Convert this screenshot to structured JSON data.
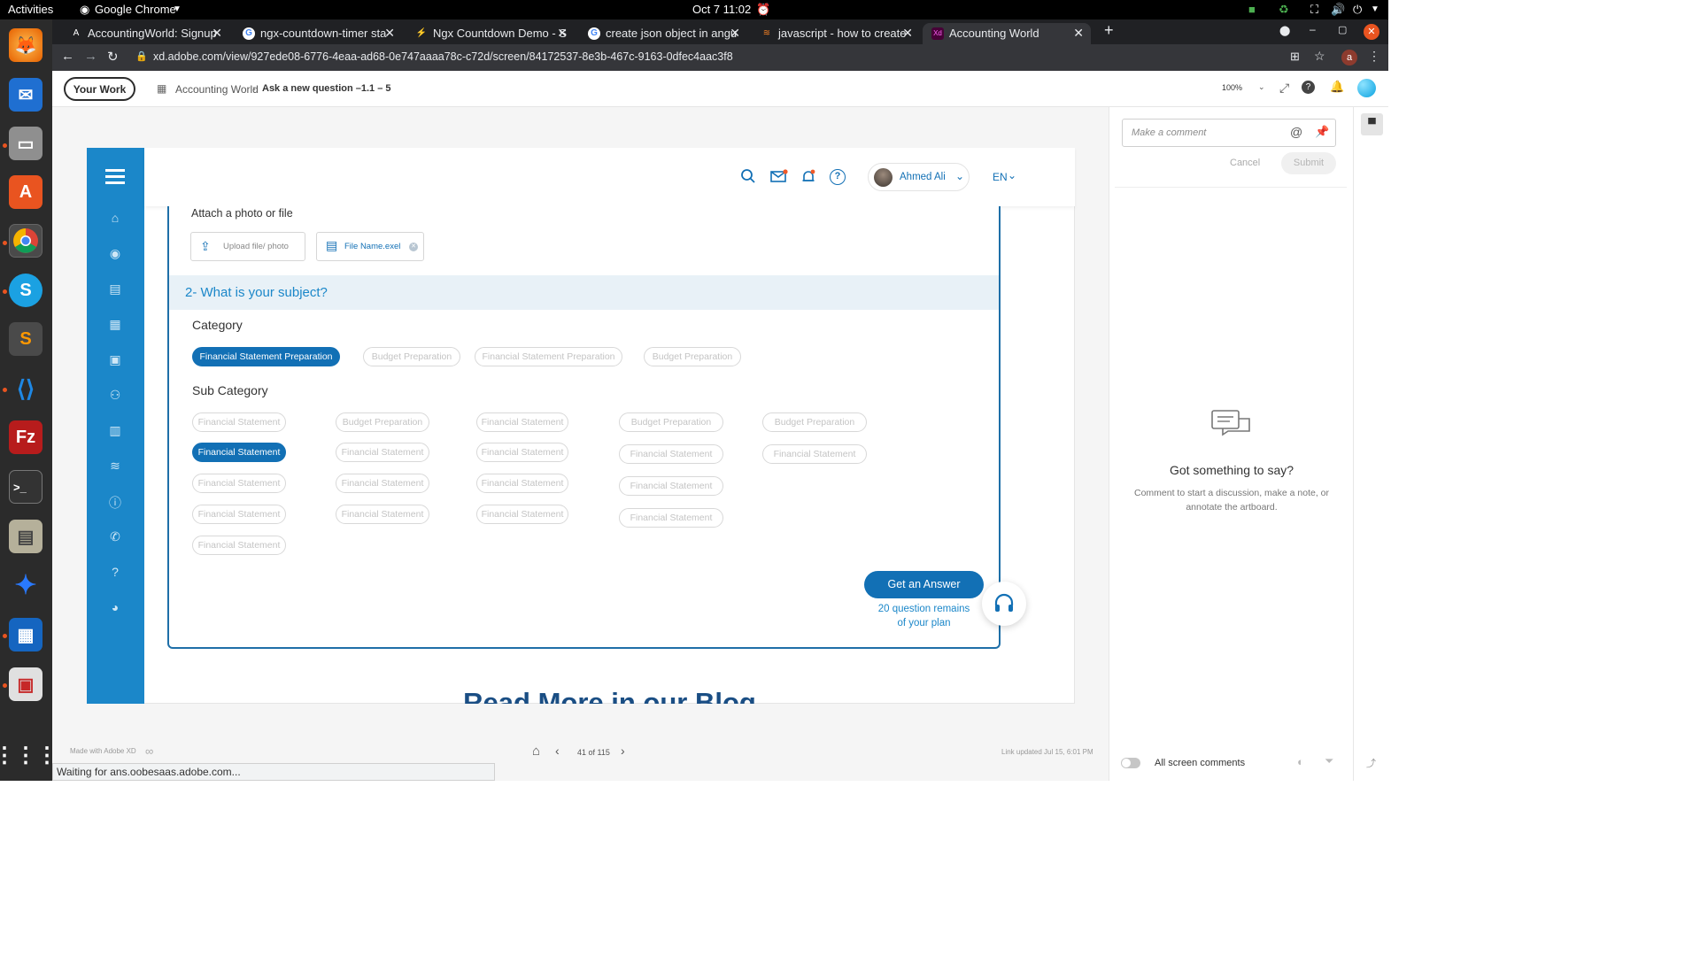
{
  "os": {
    "activities": "Activities",
    "app_name": "Google Chrome",
    "datetime": "Oct 7  11:02"
  },
  "browser": {
    "tabs": [
      {
        "title": "AccountingWorld: Signup"
      },
      {
        "title": "ngx-countdown-timer sta"
      },
      {
        "title": "Ngx Countdown Demo - S"
      },
      {
        "title": "create json object in angu"
      },
      {
        "title": "javascript - how to create"
      },
      {
        "title": "Accounting World"
      }
    ],
    "url": "xd.adobe.com/view/927ede08-6776-4eaa-ad68-0e747aaaa78c-c72d/screen/84172537-8e3b-467c-9163-0dfec4aac3f8",
    "profile_initial": "a",
    "status_text": "Waiting for ans.oobesaas.adobe.com..."
  },
  "xd": {
    "your_work": "Your Work",
    "breadcrumb_project": "Accounting World",
    "breadcrumb_screen": "Ask a new question –1.1 – 5",
    "zoom": "100%",
    "made_with": "Made with Adobe XD",
    "page_counter": "41 of 115",
    "link_updated": "Link updated Jul 15, 6:01 PM"
  },
  "comments": {
    "placeholder": "Make a comment",
    "cancel": "Cancel",
    "submit": "Submit",
    "empty_title": "Got something to say?",
    "empty_body": "Comment to start a discussion, make a note, or annotate the artboard.",
    "toggle_label": "All screen comments"
  },
  "app": {
    "user_name": "Ahmed Ali",
    "language": "EN",
    "attach_label": "Attach a photo or file",
    "upload_label": "Upload file/ photo",
    "file_name": "File Name.exel",
    "section2_title": "2- What is your subject?",
    "category_label": "Category",
    "categories": [
      {
        "label": "Financial Statement Preparation",
        "selected": true
      },
      {
        "label": "Budget Preparation",
        "selected": false
      },
      {
        "label": "Financial Statement Preparation",
        "selected": false
      },
      {
        "label": "Budget Preparation",
        "selected": false
      }
    ],
    "subcategory_label": "Sub Category",
    "subcategories": [
      {
        "label": "Financial Statement",
        "selected": false
      },
      {
        "label": "Budget Preparation",
        "selected": false
      },
      {
        "label": "Financial Statement",
        "selected": false
      },
      {
        "label": "Budget Preparation",
        "selected": false
      },
      {
        "label": "Budget Preparation",
        "selected": false
      },
      {
        "label": "Financial Statement",
        "selected": true
      },
      {
        "label": "Financial Statement",
        "selected": false
      },
      {
        "label": "Financial Statement",
        "selected": false
      },
      {
        "label": "Financial Statement",
        "selected": false
      },
      {
        "label": "Financial Statement",
        "selected": false
      },
      {
        "label": "Financial Statement",
        "selected": false
      },
      {
        "label": "Financial Statement",
        "selected": false
      },
      {
        "label": "Financial Statement",
        "selected": false
      },
      {
        "label": "Financial Statement",
        "selected": false
      },
      {
        "label": "Financial Statement",
        "selected": false
      },
      {
        "label": "Financial Statement",
        "selected": false
      },
      {
        "label": "Financial Statement",
        "selected": false
      },
      {
        "label": "Financial Statement",
        "selected": false
      },
      {
        "label": "Financial Statement",
        "selected": false
      }
    ],
    "cta_button": "Get an Answer",
    "remaining_line1": "20 question remains",
    "remaining_line2": "of your plan",
    "blog_heading": "Read More in our Blog",
    "brand_blue": "#1270b5",
    "nav_blue": "#1b87c9"
  }
}
